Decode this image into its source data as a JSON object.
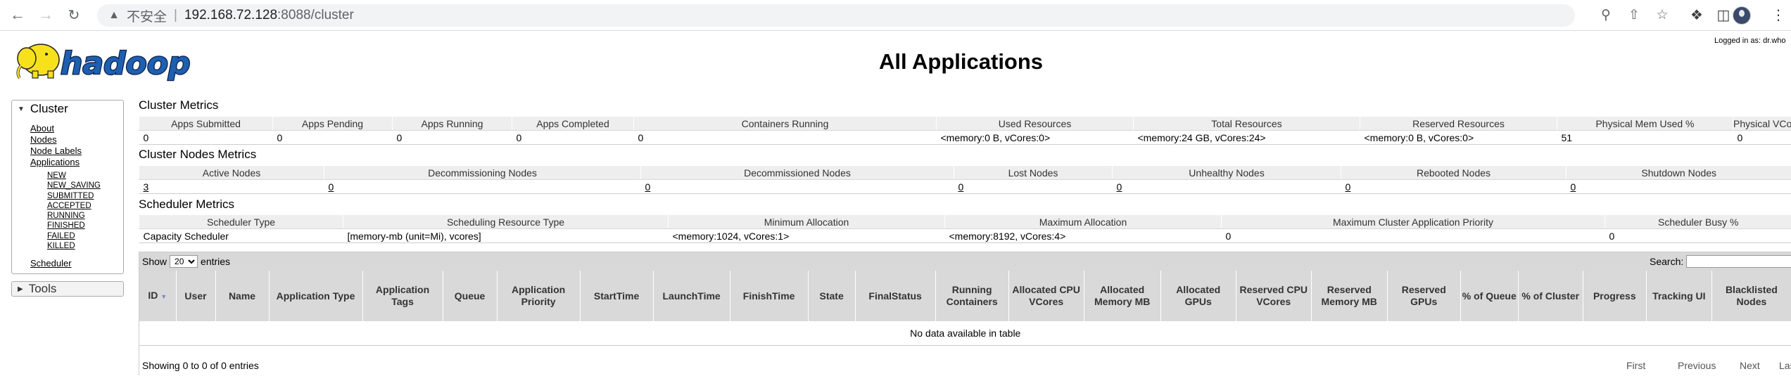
{
  "browser": {
    "insecure_label": "不安全",
    "url_host": "192.168.72.128",
    "url_rest": ":8088/cluster"
  },
  "header": {
    "title": "All Applications",
    "logged_in": "Logged in as: dr.who"
  },
  "sidebar": {
    "cluster_label": "Cluster",
    "links": [
      "About",
      "Nodes",
      "Node Labels",
      "Applications"
    ],
    "app_states": [
      "NEW",
      "NEW_SAVING",
      "SUBMITTED",
      "ACCEPTED",
      "RUNNING",
      "FINISHED",
      "FAILED",
      "KILLED"
    ],
    "scheduler_label": "Scheduler",
    "tools_label": "Tools"
  },
  "cluster_metrics": {
    "title": "Cluster Metrics",
    "headers": [
      "Apps Submitted",
      "Apps Pending",
      "Apps Running",
      "Apps Completed",
      "Containers Running",
      "Used Resources",
      "Total Resources",
      "Reserved Resources",
      "Physical Mem Used %",
      "Physical VCores Used %"
    ],
    "values": [
      "0",
      "0",
      "0",
      "0",
      "0",
      "<memory:0 B, vCores:0>",
      "<memory:24 GB, vCores:24>",
      "<memory:0 B, vCores:0>",
      "51",
      "0"
    ]
  },
  "node_metrics": {
    "title": "Cluster Nodes Metrics",
    "headers": [
      "Active Nodes",
      "Decommissioning Nodes",
      "Decommissioned Nodes",
      "Lost Nodes",
      "Unhealthy Nodes",
      "Rebooted Nodes",
      "Shutdown Nodes"
    ],
    "values": [
      "3",
      "0",
      "0",
      "0",
      "0",
      "0",
      "0"
    ]
  },
  "scheduler_metrics": {
    "title": "Scheduler Metrics",
    "headers": [
      "Scheduler Type",
      "Scheduling Resource Type",
      "Minimum Allocation",
      "Maximum Allocation",
      "Maximum Cluster Application Priority",
      "Scheduler Busy %"
    ],
    "values": [
      "Capacity Scheduler",
      "[memory-mb (unit=Mi), vcores]",
      "<memory:1024, vCores:1>",
      "<memory:8192, vCores:4>",
      "0",
      "0"
    ]
  },
  "apps": {
    "show_label": "Show",
    "page_size": "20",
    "entries_label": "entries",
    "search_label": "Search:",
    "columns": [
      "ID",
      "User",
      "Name",
      "Application Type",
      "Application Tags",
      "Queue",
      "Application Priority",
      "StartTime",
      "LaunchTime",
      "FinishTime",
      "State",
      "FinalStatus",
      "Running Containers",
      "Allocated CPU VCores",
      "Allocated Memory MB",
      "Allocated GPUs",
      "Reserved CPU VCores",
      "Reserved Memory MB",
      "Reserved GPUs",
      "% of Queue",
      "% of Cluster",
      "Progress",
      "Tracking UI",
      "Blacklisted Nodes"
    ],
    "empty_text": "No data available in table",
    "info": "Showing 0 to 0 of 0 entries",
    "pager": [
      "First",
      "Previous",
      "Next",
      "Last"
    ]
  }
}
